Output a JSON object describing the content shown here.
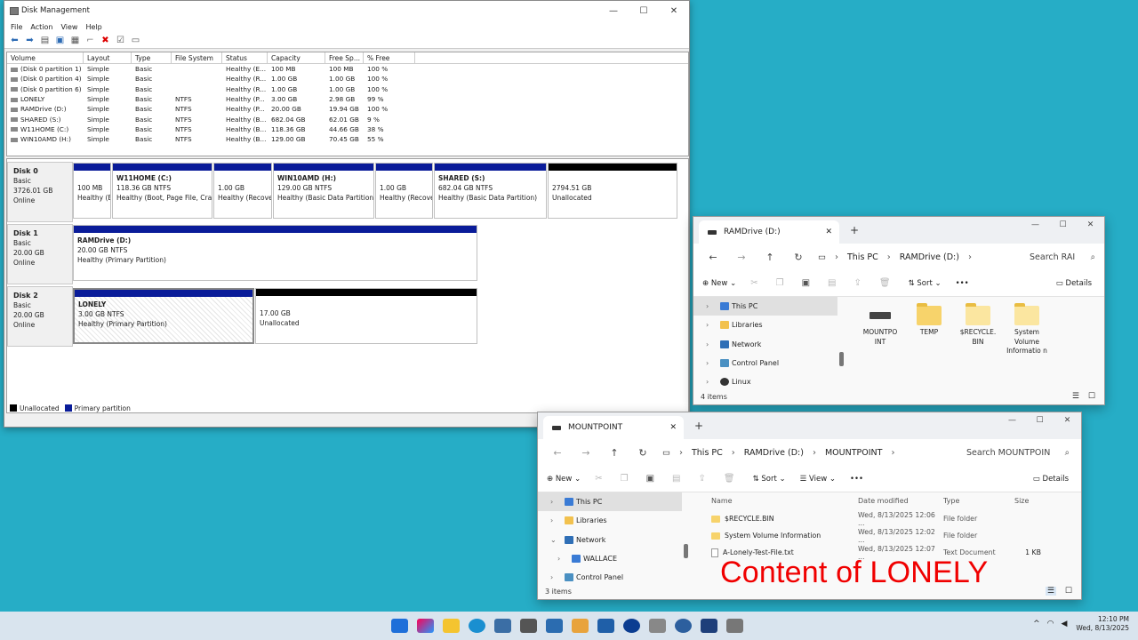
{
  "dm": {
    "title": "Disk Management",
    "menu": [
      "File",
      "Action",
      "View",
      "Help"
    ],
    "columns": [
      "Volume",
      "Layout",
      "Type",
      "File System",
      "Status",
      "Capacity",
      "Free Sp...",
      "% Free"
    ],
    "rows": [
      [
        "(Disk 0 partition 1)",
        "Simple",
        "Basic",
        "",
        "Healthy (E...",
        "100 MB",
        "100 MB",
        "100 %"
      ],
      [
        "(Disk 0 partition 4)",
        "Simple",
        "Basic",
        "",
        "Healthy (R...",
        "1.00 GB",
        "1.00 GB",
        "100 %"
      ],
      [
        "(Disk 0 partition 6)",
        "Simple",
        "Basic",
        "",
        "Healthy (R...",
        "1.00 GB",
        "1.00 GB",
        "100 %"
      ],
      [
        "LONELY",
        "Simple",
        "Basic",
        "NTFS",
        "Healthy (P...",
        "3.00 GB",
        "2.98 GB",
        "99 %"
      ],
      [
        "RAMDrive (D:)",
        "Simple",
        "Basic",
        "NTFS",
        "Healthy (P...",
        "20.00 GB",
        "19.94 GB",
        "100 %"
      ],
      [
        "SHARED (S:)",
        "Simple",
        "Basic",
        "NTFS",
        "Healthy (B...",
        "682.04 GB",
        "62.01 GB",
        "9 %"
      ],
      [
        "W11HOME (C:)",
        "Simple",
        "Basic",
        "NTFS",
        "Healthy (B...",
        "118.36 GB",
        "44.66 GB",
        "38 %"
      ],
      [
        "WIN10AMD (H:)",
        "Simple",
        "Basic",
        "NTFS",
        "Healthy (B...",
        "129.00 GB",
        "70.45 GB",
        "55 %"
      ]
    ],
    "disks": [
      {
        "name": "Disk 0",
        "l1": "Basic",
        "l2": "3726.01 GB",
        "l3": "Online"
      },
      {
        "name": "Disk 1",
        "l1": "Basic",
        "l2": "20.00 GB",
        "l3": "Online"
      },
      {
        "name": "Disk 2",
        "l1": "Basic",
        "l2": "20.00 GB",
        "l3": "Online"
      }
    ],
    "parts0": [
      {
        "t": "",
        "a": "100 MB",
        "b": "Healthy (E"
      },
      {
        "t": "W11HOME  (C:)",
        "a": "118.36 GB NTFS",
        "b": "Healthy (Boot, Page File, Crash"
      },
      {
        "t": "",
        "a": "1.00 GB",
        "b": "Healthy (Recove"
      },
      {
        "t": "WIN10AMD  (H:)",
        "a": "129.00 GB NTFS",
        "b": "Healthy (Basic Data Partition)"
      },
      {
        "t": "",
        "a": "1.00 GB",
        "b": "Healthy (Recove"
      },
      {
        "t": "SHARED  (S:)",
        "a": "682.04 GB NTFS",
        "b": "Healthy (Basic Data Partition)"
      },
      {
        "t": "",
        "a": "2794.51 GB",
        "b": "Unallocated"
      }
    ],
    "part1": {
      "t": "RAMDrive  (D:)",
      "a": "20.00 GB NTFS",
      "b": "Healthy (Primary Partition)"
    },
    "part2a": {
      "t": "LONELY",
      "a": "3.00 GB NTFS",
      "b": "Healthy (Primary Partition)"
    },
    "part2b": {
      "a": "17.00 GB",
      "b": "Unallocated"
    },
    "legend": [
      "Unallocated",
      "Primary partition"
    ],
    "colors": {
      "primary": "#0a1c99",
      "unalloc": "#000000"
    }
  },
  "ram": {
    "tab": "RAMDrive (D:)",
    "crumbs": [
      "This PC",
      "RAMDrive (D:)"
    ],
    "search": "Search RAI",
    "new": "New",
    "sort": "Sort",
    "details": "Details",
    "side": [
      "This PC",
      "Libraries",
      "Network",
      "Control Panel",
      "Linux"
    ],
    "items": [
      "MOUNTPO INT",
      "TEMP",
      "$RECYCLE. BIN",
      "System Volume Informatio n"
    ],
    "status": "4 items"
  },
  "mp": {
    "tab": "MOUNTPOINT",
    "crumbs": [
      "This PC",
      "RAMDrive (D:)",
      "MOUNTPOINT"
    ],
    "search": "Search MOUNTPOIN",
    "new": "New",
    "sort": "Sort",
    "view": "View",
    "details": "Details",
    "side": [
      "This PC",
      "Libraries",
      "Network",
      "WALLACE",
      "Control Panel"
    ],
    "cols": [
      "Name",
      "Date modified",
      "Type",
      "Size"
    ],
    "rows": [
      [
        "$RECYCLE.BIN",
        "Wed, 8/13/2025 12:06 ...",
        "File folder",
        ""
      ],
      [
        "System Volume Information",
        "Wed, 8/13/2025 12:02 ...",
        "File folder",
        ""
      ],
      [
        "A-Lonely-Test-File.txt",
        "Wed, 8/13/2025 12:07 ...",
        "Text Document",
        "1 KB"
      ]
    ],
    "status": "3 items"
  },
  "overlay": "Content of LONELY",
  "clock": {
    "time": "12:10 PM",
    "date": "Wed, 8/13/2025"
  }
}
